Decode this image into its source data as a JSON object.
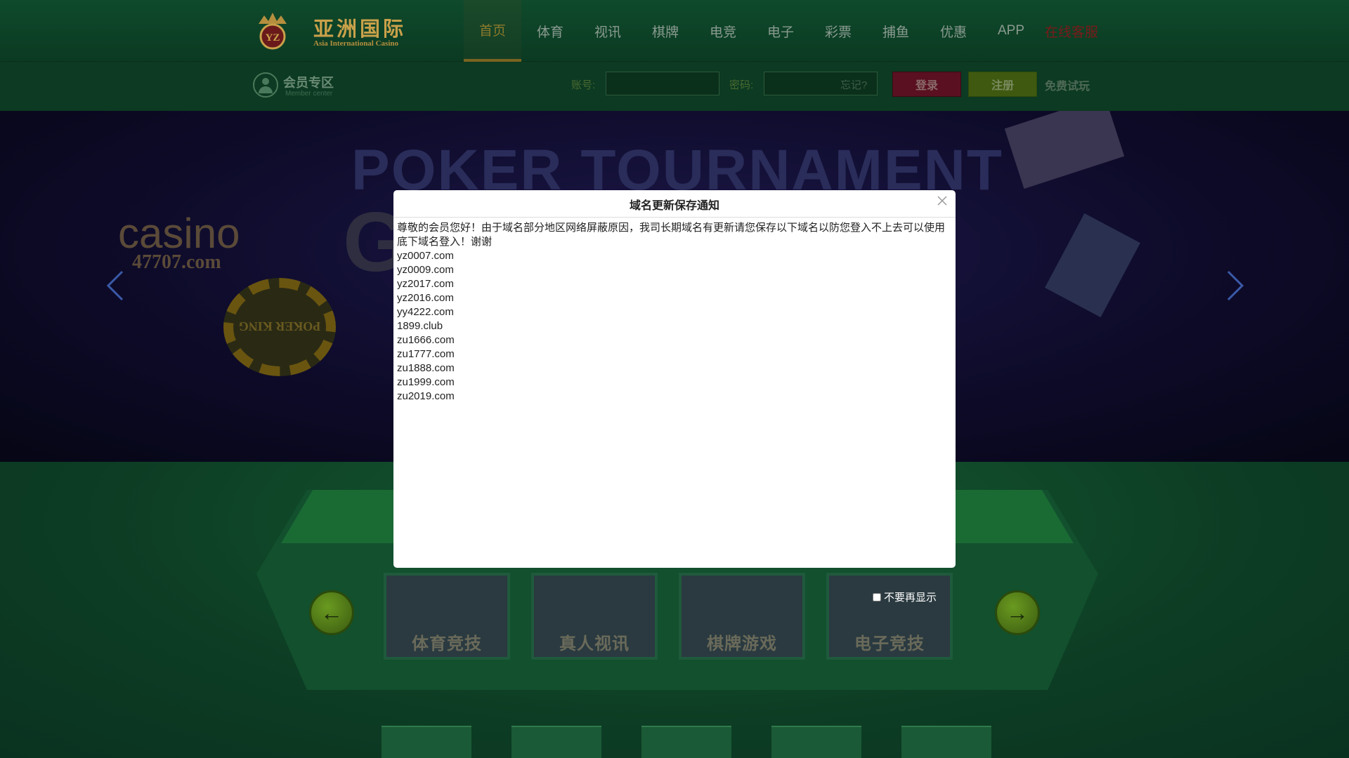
{
  "header": {
    "logo": {
      "name_cn": "亚洲国际",
      "name_en": "Asia International Casino"
    },
    "nav": [
      {
        "label": "首页",
        "active": true
      },
      {
        "label": "体育"
      },
      {
        "label": "视讯"
      },
      {
        "label": "棋牌"
      },
      {
        "label": "电竞"
      },
      {
        "label": "电子"
      },
      {
        "label": "彩票"
      },
      {
        "label": "捕鱼"
      },
      {
        "label": "优惠"
      },
      {
        "label": "APP"
      },
      {
        "label": "在线客服"
      }
    ]
  },
  "member_bar": {
    "title": "会员专区",
    "subtitle": "Member center",
    "account_label": "账号:",
    "password_label": "密码:",
    "forgot": "忘记?",
    "login_button": "登录",
    "register_button": "注册",
    "free_trial": "免费试玩"
  },
  "banner": {
    "headline": "POKER TOURNAMENT",
    "casino_word": "casino",
    "casino_domain": "47707.com",
    "chip_text": "POKER KING"
  },
  "categories": [
    {
      "label": "体育竞技"
    },
    {
      "label": "真人视讯"
    },
    {
      "label": "棋牌游戏"
    },
    {
      "label": "电子竞技"
    }
  ],
  "modal": {
    "title": "域名更新保存通知",
    "message": "尊敬的会员您好！由于域名部分地区网络屏蔽原因，我司长期域名有更新请您保存以下域名以防您登入不上去可以使用底下域名登入！谢谢",
    "domains": [
      "yz0007.com",
      "yz0009.com",
      "yz2017.com",
      "yz2016.com",
      "yy4222.com",
      "1899.club",
      "zu1666.com",
      "zu1777.com",
      "zu1888.com",
      "zu1999.com",
      "zu2019.com"
    ],
    "dont_show_label": "不要再显示"
  },
  "colors": {
    "page_green": "#0d3d24",
    "gold": "#c9a14a",
    "login_red": "#5a1020",
    "register_green": "#3f5a10"
  }
}
